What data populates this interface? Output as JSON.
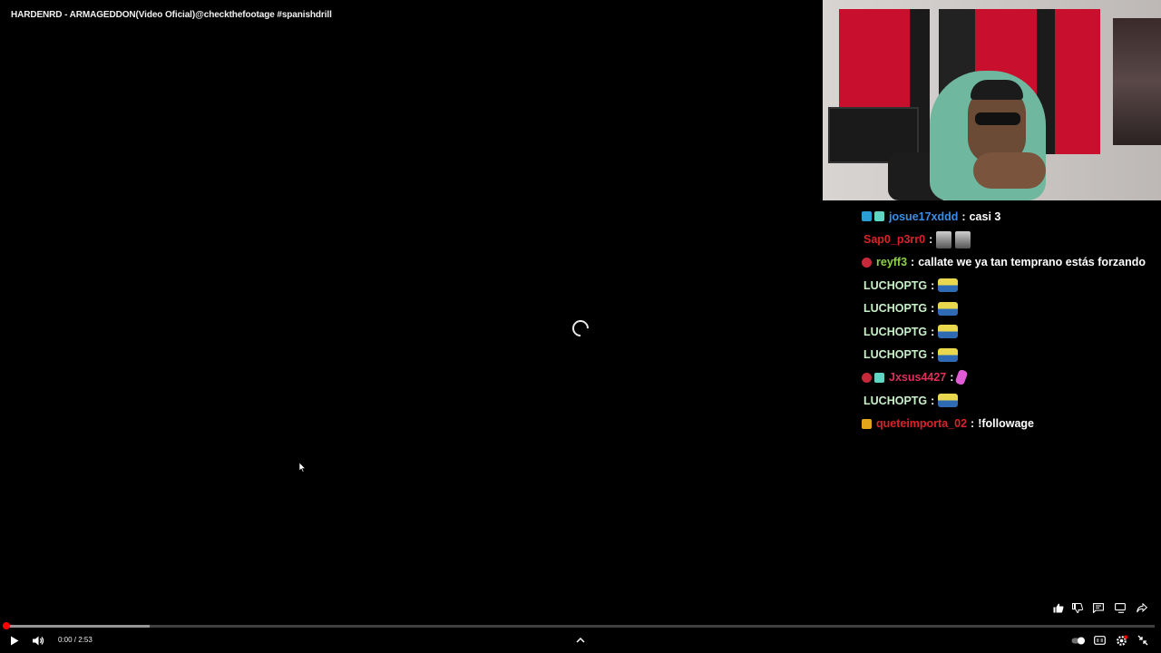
{
  "video": {
    "title": "HARDENRD - ARMAGEDDON(Video Oficial)@checkthefootage #spanishdrill",
    "time_display": "0:00 / 2:53",
    "progress_loaded_fraction": 0.125,
    "progress_played_fraction": 0.0
  },
  "chat": {
    "messages": [
      {
        "badges": [
          "b-blue",
          "b-cyan"
        ],
        "user": "josue17xddd",
        "user_color": "#3b8ee8",
        "text": "casi 3",
        "emotes": []
      },
      {
        "badges": [],
        "user": "Sap0_p3rr0",
        "user_color": "#d8232a",
        "text": "",
        "emotes": [
          "face",
          "face"
        ]
      },
      {
        "badges": [
          "b-red"
        ],
        "user": "reyff3",
        "user_color": "#8cd14a",
        "text": "callate we ya tan temprano estás forzando",
        "emotes": []
      },
      {
        "badges": [],
        "user": "LUCHOPTG",
        "user_color": "#c8f0c8",
        "text": "",
        "emotes": [
          "duck"
        ]
      },
      {
        "badges": [],
        "user": "LUCHOPTG",
        "user_color": "#c8f0c8",
        "text": "",
        "emotes": [
          "duck"
        ]
      },
      {
        "badges": [],
        "user": "LUCHOPTG",
        "user_color": "#c8f0c8",
        "text": "",
        "emotes": [
          "duck"
        ]
      },
      {
        "badges": [],
        "user": "LUCHOPTG",
        "user_color": "#c8f0c8",
        "text": "",
        "emotes": [
          "duck"
        ]
      },
      {
        "badges": [
          "b-red",
          "b-cyan"
        ],
        "user": "Jxsus4427",
        "user_color": "#e0305a",
        "text": "",
        "emotes": [
          "pink"
        ]
      },
      {
        "badges": [],
        "user": "LUCHOPTG",
        "user_color": "#c8f0c8",
        "text": "",
        "emotes": [
          "duck"
        ]
      },
      {
        "badges": [
          "b-gold"
        ],
        "user": "queteimporta_02",
        "user_color": "#d8232a",
        "text": "!followage",
        "emotes": []
      }
    ]
  },
  "icons": {
    "play": "play-icon",
    "volume": "volume-icon",
    "expand": "chevron-up-icon",
    "autoplay": "autoplay-toggle-icon",
    "captions": "captions-icon",
    "settings": "gear-icon",
    "exit_fullscreen": "exit-fullscreen-icon",
    "like": "thumbs-up-icon",
    "dislike": "thumbs-down-icon",
    "comments": "comment-icon",
    "more": "more-videos-icon",
    "share": "share-icon"
  },
  "colors": {
    "progress_accent": "#ff0000",
    "background": "#000000"
  }
}
